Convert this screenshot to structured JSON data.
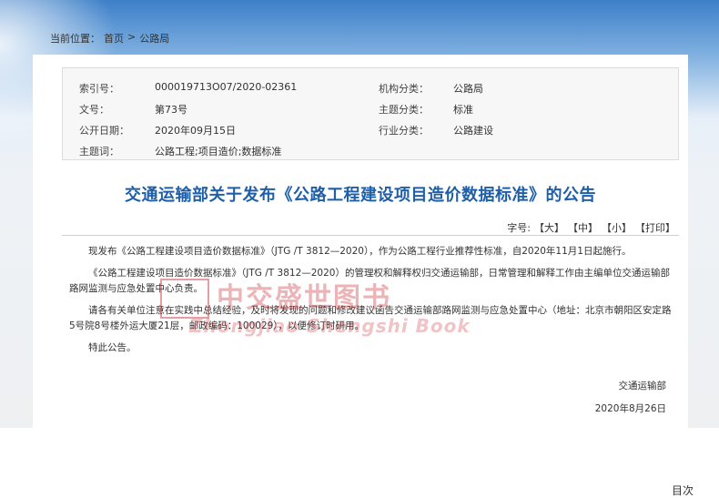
{
  "breadcrumb": {
    "label": "当前位置：",
    "home": "首页",
    "sep": ">",
    "current": "公路局"
  },
  "meta": {
    "index_label": "索引号：",
    "index_value": "000019713O07/2020-02361",
    "org_label": "机构分类：",
    "org_value": "公路局",
    "doc_label": "文号：",
    "doc_value": "第73号",
    "topic_label": "主题分类：",
    "topic_value": "标准",
    "date_label": "公开日期：",
    "date_value": "2020年09月15日",
    "industry_label": "行业分类：",
    "industry_value": "公路建设",
    "keywords_label": "主题词：",
    "keywords_value": "公路工程;项目造价;数据标准"
  },
  "article": {
    "title": "交通运输部关于发布《公路工程建设项目造价数据标准》的公告",
    "fontsize_label": "字号:",
    "fs_large": "【大】",
    "fs_medium": "【中】",
    "fs_small": "【小】",
    "print": "【打印】",
    "paragraphs": [
      "现发布《公路工程建设项目造价数据标准》（JTG /T 3812—2020），作为公路工程行业推荐性标准，自2020年11月1日起施行。",
      "《公路工程建设项目造价数据标准》（JTG /T 3812—2020）的管理权和解释权归交通运输部，日常管理和解释工作由主编单位交通运输部路网监测与应急处置中心负责。",
      "请各有关单位注意在实践中总结经验，及时将发现的问题和修改建议函告交通运输部路网监测与应急处置中心（地址：北京市朝阳区安定路5号院8号楼外运大厦21层，邮政编码：100029），以便修订时研用。",
      "特此公告。"
    ],
    "signer": "交通运输部",
    "sign_date": "2020年8月26日"
  },
  "watermark": {
    "cn": "中交盛世图书",
    "en": "Zhongjiao Shengshi Book"
  },
  "corner_text": "目次"
}
